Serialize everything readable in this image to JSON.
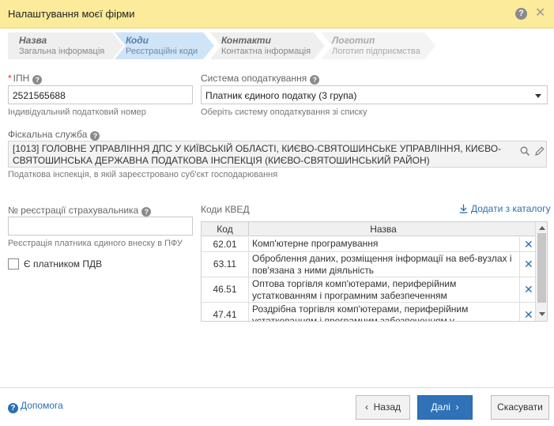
{
  "dialog": {
    "title": "Налаштування моєї фірми"
  },
  "wizard": {
    "steps": [
      {
        "title": "Назва",
        "subtitle": "Загальна інформація"
      },
      {
        "title": "Коди",
        "subtitle": "Реєстраційні коди"
      },
      {
        "title": "Контакти",
        "subtitle": "Контактна інформація"
      },
      {
        "title": "Логотип",
        "subtitle": "Логотип підприємства"
      }
    ]
  },
  "form": {
    "ipn": {
      "label": "ІПН",
      "value": "2521565688",
      "hint": "Індивідуальний податковий номер"
    },
    "tax_system": {
      "label": "Система оподаткування",
      "value": "Платник єдиного податку (3 група)",
      "hint": "Оберіть систему оподаткування зі списку"
    },
    "fiscal": {
      "label": "Фіскальна служба",
      "value": "[1013] ГОЛОВНЕ УПРАВЛІННЯ ДПС У КИЇВСЬКІЙ ОБЛАСТІ, КИЄВО-СВЯТОШИНСЬКЕ УПРАВЛІННЯ, КИЄВО-СВЯТОШИНСЬКА ДЕРЖАВНА ПОДАТКОВА ІНСПЕКЦІЯ (КИЄВО-СВЯТОШИНСЬКИЙ РАЙОН)",
      "hint": "Податкова інспекція, в якій зареєстровано суб'єкт господарювання"
    },
    "insurer": {
      "label": "№ реєстрації страхувальника",
      "value": "",
      "hint": "Реєстрація платника єдиного внеску в ПФУ"
    },
    "vat": {
      "label": "Є платником ПДВ",
      "checked": false
    }
  },
  "kved": {
    "label": "Коди КВЕД",
    "add_link": "Додати з каталогу",
    "columns": {
      "code": "Код",
      "name": "Назва"
    },
    "rows": [
      {
        "code": "62.01",
        "name": "Комп'ютерне програмування"
      },
      {
        "code": "63.11",
        "name": "Оброблення даних, розміщення інформації на веб-вузлах і пов'язана з ними діяльність"
      },
      {
        "code": "46.51",
        "name": "Оптова торгівля комп'ютерами, периферійним устаткованням і програмним забезпеченням"
      },
      {
        "code": "47.41",
        "name": "Роздрібна торгівля комп'ютерами, периферійним устаткованням і програмним забезпеченням у спеціалізованих магазинах"
      }
    ]
  },
  "footer": {
    "help": "Допомога",
    "back": "Назад",
    "next": "Далі",
    "cancel": "Скасувати"
  },
  "icons": {
    "help": "question-circle-icon",
    "close": "close-icon",
    "search": "search-icon",
    "edit": "pencil-icon",
    "download": "download-icon",
    "delete": "x-icon",
    "chevron_left": "chevron-left-icon",
    "chevron_right": "chevron-right-icon"
  },
  "colors": {
    "titlebar": "#fbeb9a",
    "active_step": "#cfe4f7",
    "primary": "#2f72b8",
    "link": "#2a6fb0"
  }
}
